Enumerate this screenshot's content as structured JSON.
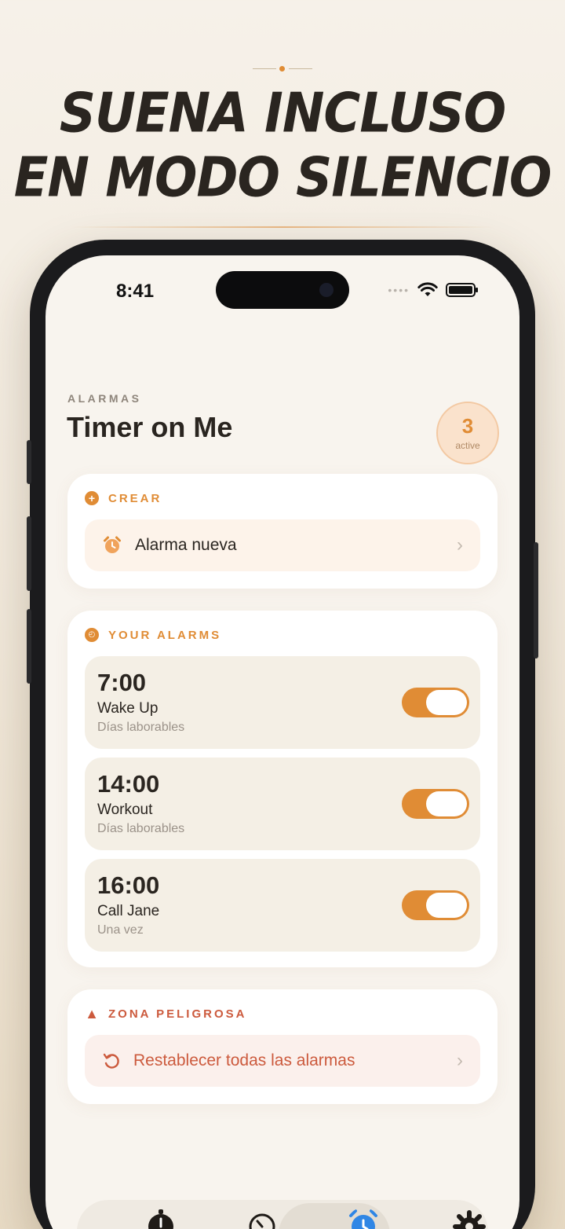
{
  "headline": {
    "line1": "SUENA INCLUSO",
    "line2": "EN MODO SILENCIO"
  },
  "status_bar": {
    "time": "8:41",
    "signal": "••••"
  },
  "header": {
    "eyebrow": "ALARMAS",
    "title": "Timer on Me",
    "active_count": "3",
    "active_label": "active"
  },
  "create_section": {
    "title": "CREAR",
    "new_alarm_label": "Alarma nueva"
  },
  "alarms_section": {
    "title": "YOUR ALARMS",
    "alarms": [
      {
        "time": "7:00",
        "name": "Wake Up",
        "repeat": "Días laborables",
        "enabled": true
      },
      {
        "time": "14:00",
        "name": "Workout",
        "repeat": "Días laborables",
        "enabled": true
      },
      {
        "time": "16:00",
        "name": "Call Jane",
        "repeat": "Una vez",
        "enabled": true
      }
    ]
  },
  "danger_section": {
    "title": "ZONA PELIGROSA",
    "reset_label": "Restablecer todas las alarmas"
  },
  "tabbar": {
    "tabs": [
      {
        "icon": "stopwatch-icon",
        "selected": false
      },
      {
        "icon": "timer-icon",
        "selected": false
      },
      {
        "icon": "alarm-clock-icon",
        "selected": true
      },
      {
        "icon": "gear-icon",
        "selected": false
      }
    ]
  },
  "colors": {
    "accent": "#e08c35",
    "danger": "#cc5a3d",
    "background": "#f8f4ee"
  }
}
